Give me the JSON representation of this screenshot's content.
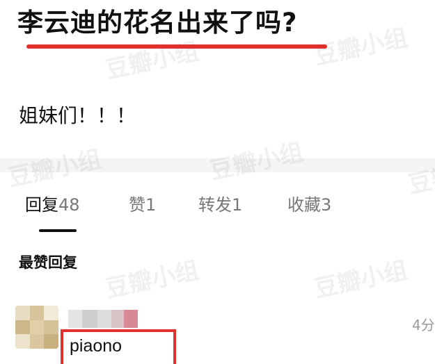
{
  "post": {
    "title": "李云迪的花名出来了吗?",
    "body": "姐妹们！！！"
  },
  "tabs": [
    {
      "label": "回复",
      "count": "48"
    },
    {
      "label": "赞",
      "count": "1"
    },
    {
      "label": "转发",
      "count": "1"
    },
    {
      "label": "收藏",
      "count": "3"
    }
  ],
  "replies": {
    "section_heading": "最赞回复",
    "first_reply": {
      "username": "piaono",
      "timestamp": "4分"
    }
  },
  "watermark": "豆瓣小组",
  "colors": {
    "highlight_red": "#e0312f",
    "muted_text": "#777777"
  }
}
